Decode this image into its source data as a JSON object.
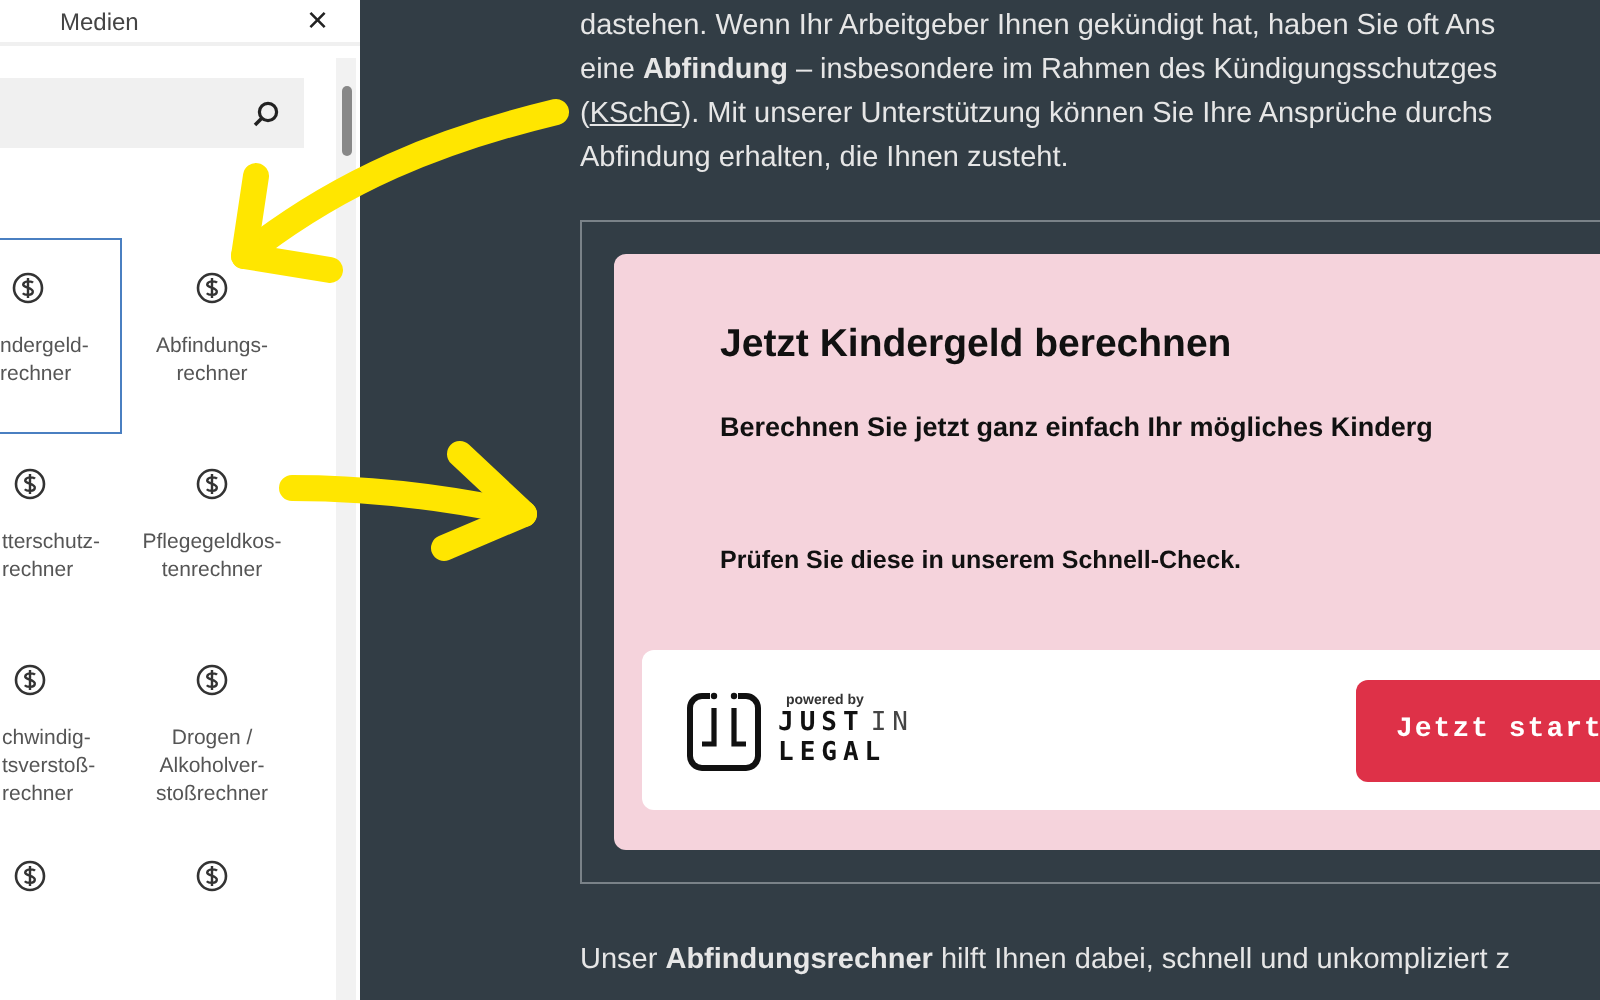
{
  "panel": {
    "title": "Medien",
    "close": "×",
    "items": [
      {
        "label": "ndergeld-\nrechner",
        "selected": true
      },
      {
        "label": "Abfindungs-\nrechner",
        "selected": false
      },
      {
        "label": "tterschutz-\nrechner",
        "selected": false
      },
      {
        "label": "Pflegegeldkos-\ntenrechner",
        "selected": false
      },
      {
        "label": "chwindig-\ntsverstoß-\nrechner",
        "selected": false
      },
      {
        "label": "Drogen /\nAlkoholver-\nstoßrechner",
        "selected": false
      },
      {
        "selected": false
      },
      {
        "selected": false
      }
    ]
  },
  "article": {
    "lines": [
      {
        "text": "dastehen. Wenn Ihr Arbeitgeber Ihnen gekündigt hat, haben Sie oft Ans"
      },
      {
        "text": "eine **Abfindung** – insbesondere im Rahmen des Kündigungsschutzges"
      },
      {
        "pre": "(",
        "link": "KSchG",
        "text": "). Mit unserer Unterstützung können Sie Ihre Ansprüche durchs"
      },
      {
        "text": "Abfindung erhalten, die Ihnen zusteht."
      }
    ],
    "widget": {
      "title": "Jetzt Kindergeld berechnen",
      "subtitle": "Berechnen Sie jetzt ganz einfach Ihr mögliches Kinderg",
      "text": "Prüfen Sie diese in unserem Schnell-Check.",
      "powered_by": "powered by",
      "logo_words": [
        "JUST",
        "IN",
        "LEGAL"
      ],
      "button": "Jetzt start"
    },
    "footer": "Unser **Abfindungsrechner** hilft Ihnen dabei, schnell und unkompliziert z"
  }
}
